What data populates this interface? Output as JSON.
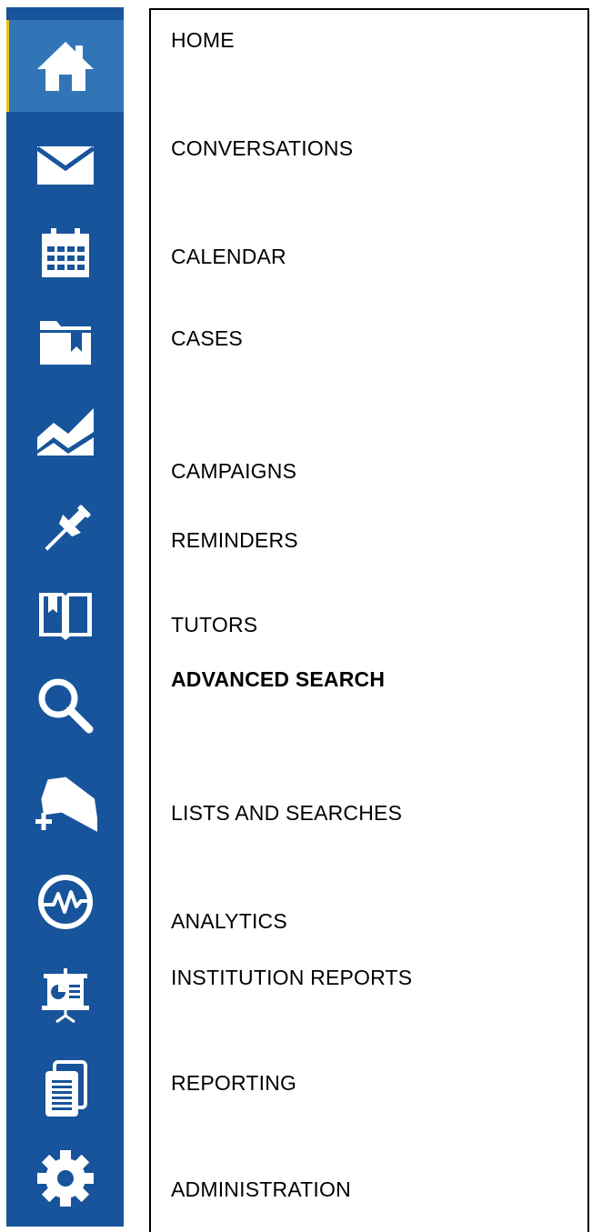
{
  "sidebar": {
    "background": "#17549b",
    "active_background": "#3275b6",
    "active_indicator": "#e9c11e",
    "icon_color": "#ffffff",
    "icons": [
      "home-icon",
      "mail-icon",
      "calendar-icon",
      "folder-icon",
      "chart-icon",
      "pin-icon",
      "book-icon",
      "search-icon",
      "tag-add-icon",
      "pulse-icon",
      "presentation-icon",
      "documents-icon",
      "gear-icon"
    ]
  },
  "menu": {
    "items": [
      {
        "label": "HOME"
      },
      {
        "label": "CONVERSATIONS"
      },
      {
        "label": "CALENDAR"
      },
      {
        "label": "CASES"
      },
      {
        "label": "CAMPAIGNS"
      },
      {
        "label": "REMINDERS"
      },
      {
        "label": "TUTORS"
      },
      {
        "label": "ADVANCED SEARCH"
      },
      {
        "label": "LISTS AND SEARCHES"
      },
      {
        "label": "ANALYTICS"
      },
      {
        "label": "INSTITUTION REPORTS"
      },
      {
        "label": "REPORTING"
      },
      {
        "label": "ADMINISTRATION"
      }
    ]
  }
}
